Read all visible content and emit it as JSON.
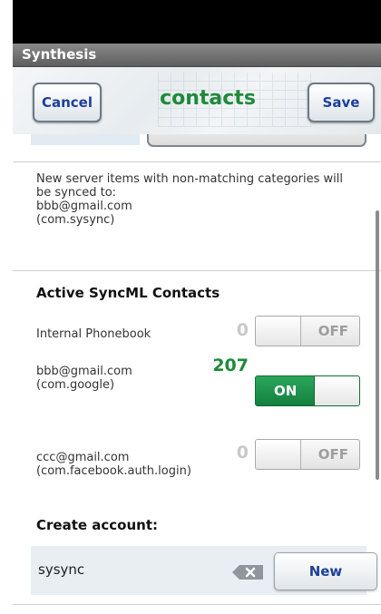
{
  "app": {
    "title": "Synthesis"
  },
  "header": {
    "cancel_label": "Cancel",
    "title": "contacts",
    "save_label": "Save"
  },
  "info": {
    "lines": [
      "New server items with non-matching categories will",
      "be synced to:",
      "bbb@gmail.com",
      "(com.sysync)"
    ]
  },
  "active_section": {
    "title": "Active SyncML Contacts",
    "rows": [
      {
        "label_lines": [
          "Internal Phonebook"
        ],
        "count": "0",
        "toggle": "OFF"
      },
      {
        "label_lines": [
          "bbb@gmail.com",
          "(com.google)"
        ],
        "count": "207",
        "toggle": "ON"
      },
      {
        "label_lines": [
          "ccc@gmail.com",
          "(com.facebook.auth.login)"
        ],
        "count": "0",
        "toggle": "OFF"
      }
    ]
  },
  "create_account": {
    "title": "Create account:",
    "input_value": "sysync",
    "new_label": "New"
  },
  "colors": {
    "accent_green": "#1e8a3a",
    "button_text_blue": "#1d3f9c"
  }
}
